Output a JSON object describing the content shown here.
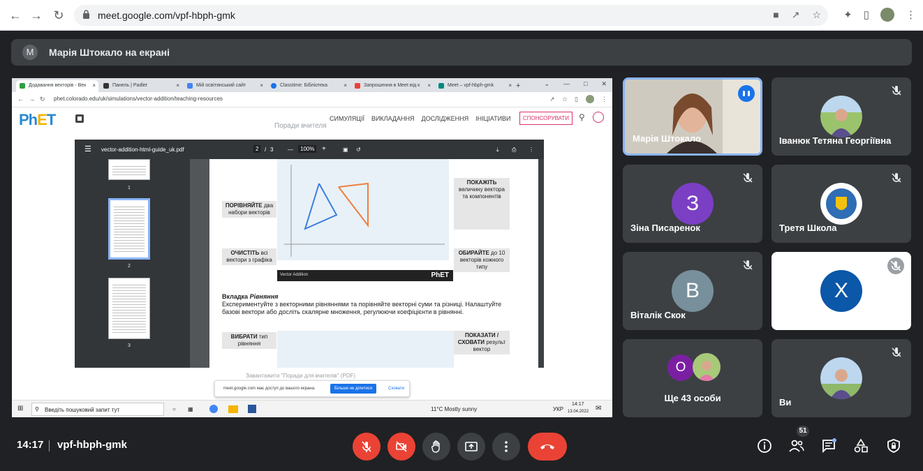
{
  "browser": {
    "url": "meet.google.com/vpf-hbph-gmk"
  },
  "presenting": {
    "avatar_letter": "M",
    "text": "Марія Штокало на екрані"
  },
  "shared_screen": {
    "tabs": [
      {
        "label": "Додавання векторів - Век",
        "color": "#2f9e44"
      },
      {
        "label": "Панель | Padlet",
        "color": "#333333"
      },
      {
        "label": "Мій освітянський сайт",
        "color": "#4285f4"
      },
      {
        "label": "Classtime: Бібліотека",
        "color": "#1a73e8"
      },
      {
        "label": "Запрошення в Meet від к",
        "color": "#ea4335"
      },
      {
        "label": "Meet – vpf-hbph-gmk",
        "color": "#00897b"
      }
    ],
    "address": "phet.colorado.edu/uk/simulations/vector-addition/teaching-resources",
    "phet_logo": "PhET",
    "nav": [
      "СИМУЛЯЦІЇ",
      "ВИКЛАДАННЯ",
      "ДОСЛІДЖЕННЯ",
      "ІНІЦІАТИВИ"
    ],
    "sponsor": "СПОНСОРУВАТИ",
    "faded_title": "Поради вчителя",
    "pdf": {
      "filename": "vector-addition-html-guide_uk.pdf",
      "page_current": "2",
      "page_total": "3",
      "zoom": "100%",
      "thumb_pages": [
        "1",
        "2",
        "3"
      ]
    },
    "callouts": {
      "compare": "ПОРІВНЯЙТЕ",
      "compare_rest": "два набори векторів",
      "clear": "ОЧИСТІТЬ",
      "clear_rest": "всі вектори з графіка",
      "show": "ПОКАЖІТЬ",
      "show_rest": "величину вектора та компонентів",
      "choose": "ОБИРАЙТЕ",
      "choose_rest": "до 10 векторів кожного типу",
      "select": "ВИБРАТИ",
      "select_rest": "тип рівняння",
      "show_hide": "ПОКАЗАТИ / СХОВАТИ",
      "show_hide_rest": "результ вектор"
    },
    "sim_footer": "Vector Addition",
    "page_heading": "Вкладка",
    "page_heading_em": "Рівняння",
    "page_body": "Експериментуйте з векторними рівняннями та порівняйте векторні суми та різниці. Налаштуйте базові вектори або досліть скалярне множення, регулюючи коефіцієнти в рівнянні.",
    "below_text": "Завантажити \"Поради для вчителів\" (PDF)",
    "share_msg": "meet.google.com має доступ до вашого екрана.",
    "share_stop": "Більше не ділитися",
    "share_hide": "Сховати",
    "taskbar": {
      "search": "Введіть пошуковий запит тут",
      "weather": "11°C  Mostly sunny",
      "lang": "УКР",
      "time": "14:17",
      "date": "13.04.2022"
    }
  },
  "participants": [
    {
      "name": "Марія Штокало",
      "type": "video"
    },
    {
      "name": "Іванюк Тетяна Георгіївна",
      "type": "photo"
    },
    {
      "name": "Зіна Писаренок",
      "letter": "З",
      "color": "#7b3fc4"
    },
    {
      "name": "Третя Школа",
      "type": "emblem"
    },
    {
      "name": "Віталік Скок",
      "letter": "В",
      "color": "#78909c"
    },
    {
      "name": "",
      "letter": "X",
      "color": "#0b57a8"
    },
    {
      "name": "Ще 43 особи",
      "letter": "О",
      "color": "#7b1fa2"
    },
    {
      "name": "Ви",
      "type": "photo"
    }
  ],
  "meeting": {
    "time": "14:17",
    "code": "vpf-hbph-gmk",
    "participant_count": "51"
  },
  "colors": {
    "meet_bg": "#202124",
    "tile_bg": "#3c4043",
    "danger": "#ea4335",
    "accent": "#1a73e8"
  }
}
